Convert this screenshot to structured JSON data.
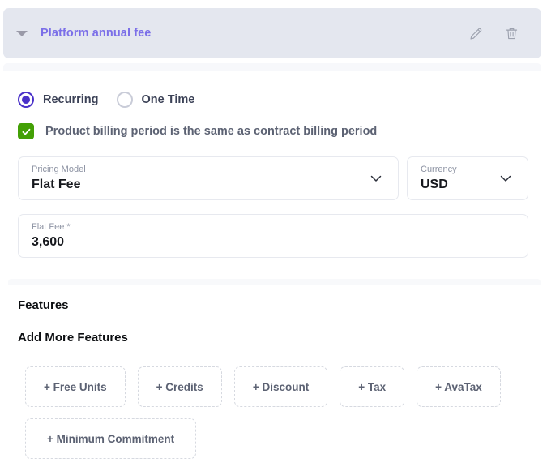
{
  "header": {
    "title": "Platform annual fee",
    "collapse_icon": "caret-down-icon",
    "edit_icon": "pencil-icon",
    "delete_icon": "trash-icon",
    "title_color": "#7b6fe8",
    "background_color": "#e4e7ef"
  },
  "billing_type": {
    "options": [
      {
        "label": "Recurring",
        "selected": true
      },
      {
        "label": "One Time",
        "selected": false
      }
    ],
    "selected_color": "#4a31c9"
  },
  "billing_period_checkbox": {
    "label": "Product billing period is the same as contract billing period",
    "checked": true,
    "check_color": "#43a006"
  },
  "fields": {
    "pricing_model": {
      "label": "Pricing Model",
      "value": "Flat Fee"
    },
    "currency": {
      "label": "Currency",
      "value": "USD"
    },
    "flat_fee": {
      "label": "Flat Fee *",
      "value": "3,600"
    }
  },
  "features": {
    "section_title": "Features",
    "add_more_title": "Add More Features",
    "chips": [
      {
        "label": "+ Free Units"
      },
      {
        "label": "+ Credits"
      },
      {
        "label": "+ Discount"
      },
      {
        "label": "+ Tax"
      },
      {
        "label": "+ AvaTax"
      },
      {
        "label": "+ Minimum Commitment"
      }
    ]
  }
}
